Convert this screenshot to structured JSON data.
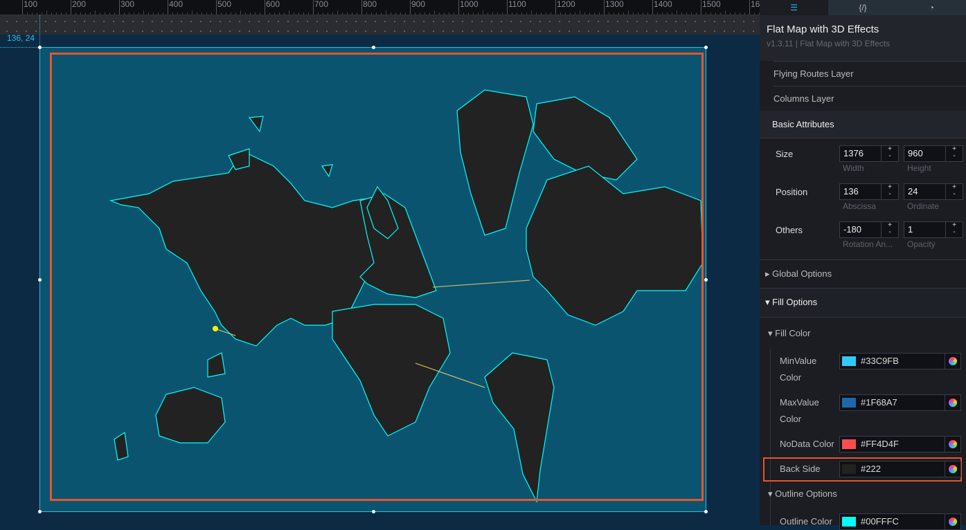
{
  "ruler": {
    "labels": [
      "100",
      "200",
      "300",
      "400",
      "500",
      "600",
      "700",
      "800",
      "900",
      "1000",
      "1100",
      "1200",
      "1300",
      "1400",
      "1500",
      "16"
    ]
  },
  "canvas": {
    "coord_readout": "136, 24"
  },
  "panel": {
    "tabs": [
      {
        "icon": "sliders-icon"
      },
      {
        "label": "{/}"
      },
      {
        "icon": "cursor-icon"
      }
    ],
    "title": "Flat Map with 3D Effects",
    "subtitle": "v1.3.11 | Flat Map with 3D Effects",
    "layers": [
      "Flying Routes Layer",
      "Columns Layer"
    ],
    "basic_attributes": "Basic Attributes",
    "size": {
      "label": "Size",
      "width": "1376",
      "height": "960",
      "width_cap": "Width",
      "height_cap": "Height"
    },
    "position": {
      "label": "Position",
      "x": "136",
      "y": "24",
      "x_cap": "Abscissa",
      "y_cap": "Ordinate"
    },
    "others": {
      "label": "Others",
      "rotation": "-180",
      "opacity": "1",
      "rotation_cap": "Rotation An...",
      "opacity_cap": "Opacity"
    },
    "global_options": "Global Options",
    "fill_options": "Fill Options",
    "fill_color": "Fill Color",
    "colors": [
      {
        "label1": "MinValue",
        "label2": "Color",
        "value": "#33C9FB",
        "swatch": "#33C9FB"
      },
      {
        "label1": "MaxValue",
        "label2": "Color",
        "value": "#1F68A7",
        "swatch": "#1F68A7"
      },
      {
        "label1": "NoData Color",
        "label2": "",
        "value": "#FF4D4F",
        "swatch": "#FF4D4F"
      },
      {
        "label1": "Back Side",
        "label2": "",
        "value": "#222",
        "swatch": "#222222"
      }
    ],
    "outline_options": "Outline Options",
    "outline_color": {
      "label": "Outline Color",
      "value": "#00FFFC",
      "swatch": "#00FFFC"
    }
  },
  "colors": {
    "accent": "#27C0E0",
    "highlight": "#E8542C",
    "land": "#222222",
    "outline": "#00FFFC"
  }
}
